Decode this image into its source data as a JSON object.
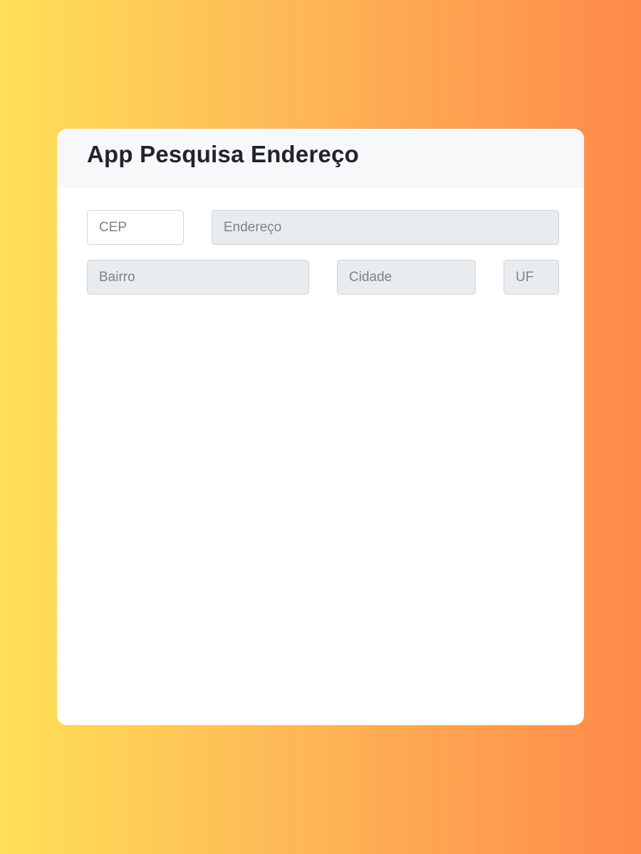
{
  "app": {
    "title": "App Pesquisa Endereço"
  },
  "form": {
    "cep": {
      "placeholder": "CEP",
      "value": ""
    },
    "endereco": {
      "placeholder": "Endereço",
      "value": ""
    },
    "bairro": {
      "placeholder": "Bairro",
      "value": ""
    },
    "cidade": {
      "placeholder": "Cidade",
      "value": ""
    },
    "uf": {
      "placeholder": "UF",
      "value": ""
    }
  },
  "colors": {
    "gradient_start": "#ffe057",
    "gradient_end": "#ff8a4b",
    "card_bg": "#ffffff",
    "header_bg": "#f7f8f9",
    "readonly_field_bg": "#e9ecef",
    "title_text": "#212529"
  }
}
